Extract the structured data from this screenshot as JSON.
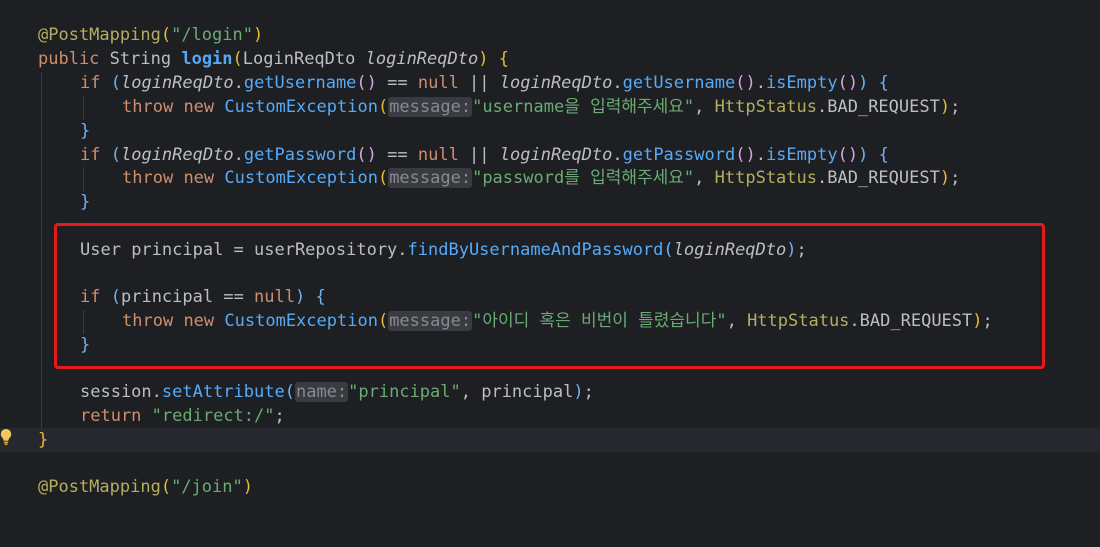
{
  "colors": {
    "background": "#1e1f22",
    "current_line": "#26282e",
    "keyword": "#cf8e6d",
    "string": "#6aab73",
    "method": "#57aaf7",
    "annotation": "#b3ae60",
    "highlight_border": "#e41b1b"
  },
  "icons": {
    "gutter": "lightbulb-icon"
  },
  "lines": [
    {
      "tokens": [
        "@PostMapping",
        "(",
        "\"/login\"",
        ")"
      ]
    },
    {
      "tokens": [
        "public",
        " ",
        "String",
        " ",
        "login",
        "(",
        "LoginReqDto",
        " ",
        "loginReqDto",
        ")",
        " ",
        "{"
      ]
    },
    {
      "tokens": [
        "if",
        " ",
        "(",
        "loginReqDto",
        ".",
        "getUsername",
        "()",
        " == ",
        "null",
        " || ",
        "loginReqDto",
        ".",
        "getUsername",
        "()",
        ".",
        "isEmpty",
        "()",
        ")",
        " ",
        "{"
      ]
    },
    {
      "tokens": [
        "throw",
        " ",
        "new",
        " ",
        "CustomException",
        "(",
        "message:",
        "\"username을 입력해주세요\"",
        ", ",
        "HttpStatus",
        ".",
        "BAD_REQUEST",
        ")",
        ";"
      ]
    },
    {
      "tokens": [
        "}"
      ]
    },
    {
      "tokens": [
        "if",
        " ",
        "(",
        "loginReqDto",
        ".",
        "getPassword",
        "()",
        " == ",
        "null",
        " || ",
        "loginReqDto",
        ".",
        "getPassword",
        "()",
        ".",
        "isEmpty",
        "()",
        ")",
        " ",
        "{"
      ]
    },
    {
      "tokens": [
        "throw",
        " ",
        "new",
        " ",
        "CustomException",
        "(",
        "message:",
        "\"password를 입력해주세요\"",
        ", ",
        "HttpStatus",
        ".",
        "BAD_REQUEST",
        ")",
        ";"
      ]
    },
    {
      "tokens": [
        "}"
      ]
    },
    {
      "tokens": [
        "User",
        " principal = userRepository.",
        "findByUsernameAndPassword",
        "(",
        "loginReqDto",
        ")",
        ";"
      ]
    },
    {
      "tokens": [
        "if",
        " ",
        "(",
        "principal == ",
        "null",
        ")",
        " ",
        "{"
      ]
    },
    {
      "tokens": [
        "throw",
        " ",
        "new",
        " ",
        "CustomException",
        "(",
        "message:",
        "\"아이디 혹은 비번이 틀렸습니다\"",
        ", ",
        "HttpStatus",
        ".",
        "BAD_REQUEST",
        ")",
        ";"
      ]
    },
    {
      "tokens": [
        "}"
      ]
    },
    {
      "tokens": [
        "session.",
        "setAttribute",
        "(",
        "name:",
        "\"principal\"",
        ", principal",
        ")",
        ";"
      ]
    },
    {
      "tokens": [
        "return",
        " ",
        "\"redirect:/\"",
        ";"
      ]
    },
    {
      "tokens": [
        "}"
      ]
    },
    {
      "tokens": [
        "@PostMapping",
        "(",
        "\"/join\"",
        ")"
      ]
    }
  ]
}
